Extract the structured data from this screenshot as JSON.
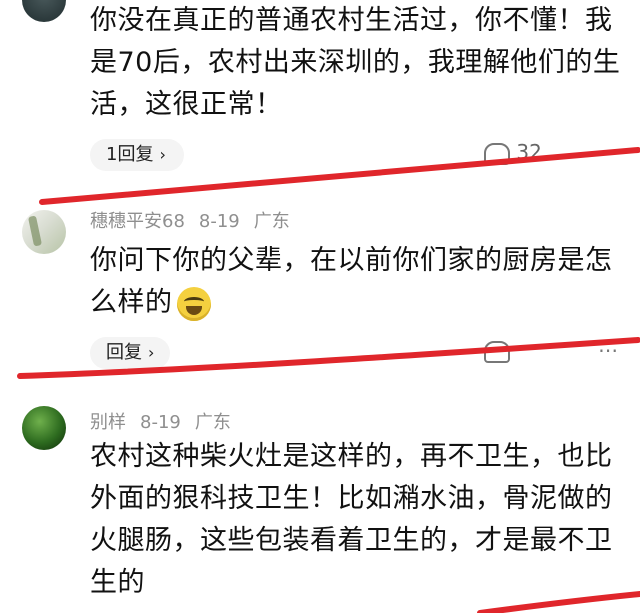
{
  "comments": [
    {
      "text": "你没在真正的普通农村生活过，你不懂！我是70后，农村出来深圳的，我理解他们的生活，这很正常！",
      "reply_label": "1回复",
      "like_count": "32"
    },
    {
      "username": "穗穗平安68",
      "date": "8-19",
      "location": "广东",
      "text": "你问下你的父辈，在以前你们家的厨房是怎么样的",
      "reply_label": "回复"
    },
    {
      "username": "别样",
      "date": "8-19",
      "location": "广东",
      "text": "农村这种柴火灶是这样的，再不卫生，也比外面的狠科技卫生！比如潲水油，骨泥做的火腿肠，这些包装看着卫生的，才是最不卫生的"
    }
  ],
  "icons": {
    "chevron": "chevron-right-icon",
    "like": "heart-icon",
    "more": "more-icon"
  },
  "colors": {
    "annotation_line": "#e0262b",
    "meta_text": "#8f8f8f",
    "body_text": "#111111"
  }
}
